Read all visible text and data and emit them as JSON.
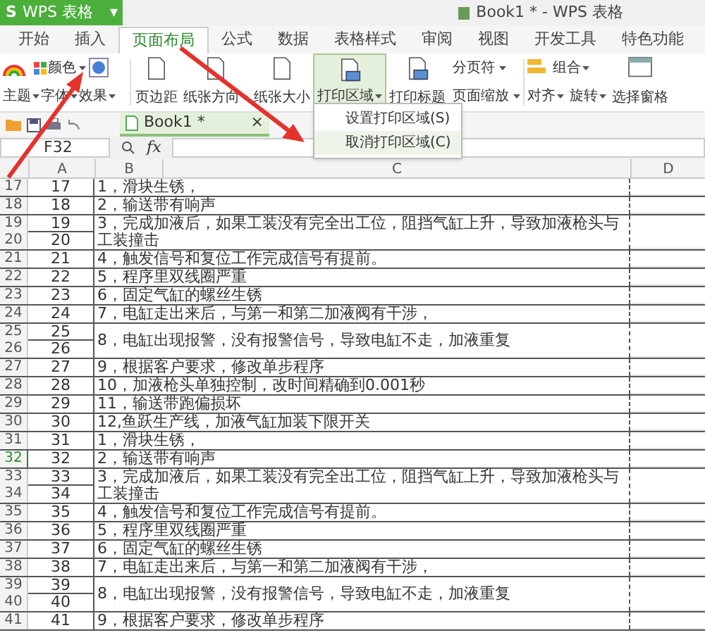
{
  "app_button": {
    "logo": "S",
    "label": "WPS 表格",
    "caret": "▾"
  },
  "window": {
    "title": "Book1 * - WPS 表格"
  },
  "tabs": [
    {
      "label": "开始",
      "selected": false
    },
    {
      "label": "插入",
      "selected": false
    },
    {
      "label": "页面布局",
      "selected": true
    },
    {
      "label": "公式",
      "selected": false
    },
    {
      "label": "数据",
      "selected": false
    },
    {
      "label": "表格样式",
      "selected": false
    },
    {
      "label": "审阅",
      "selected": false
    },
    {
      "label": "视图",
      "selected": false
    },
    {
      "label": "开发工具",
      "selected": false
    },
    {
      "label": "特色功能",
      "selected": false
    }
  ],
  "ribbon": {
    "theme": "主题",
    "colors": "颜色",
    "font": "字体",
    "effects": "效果",
    "big_buttons": [
      {
        "label": "页边距",
        "caret": false,
        "active": false
      },
      {
        "label": "纸张方向",
        "caret": true,
        "active": false
      },
      {
        "label": "纸张大小",
        "caret": false,
        "active": false
      },
      {
        "label": "打印区域",
        "caret": true,
        "active": true
      },
      {
        "label": "打印标题",
        "caret": false,
        "active": false
      }
    ],
    "page_break": "分页符",
    "page_zoom": "页面缩放",
    "align": "对齐",
    "group": "组合",
    "rotate": "旋转",
    "selection_pane": "选择窗格"
  },
  "document_tab": {
    "title": "Book1 *",
    "close": "×"
  },
  "menu": {
    "items": [
      {
        "label": "设置打印区域(S)",
        "hovered": false
      },
      {
        "label": "取消打印区域(C)",
        "hovered": true
      }
    ]
  },
  "formula_bar": {
    "name_box": "F32",
    "fx": "fx"
  },
  "sheet": {
    "columns": [
      "A",
      "B",
      "C",
      "D"
    ],
    "entries": [
      {
        "rows": [
          {
            "header": "17",
            "a": "17",
            "selected": false
          }
        ],
        "text": "1，滑块生锈，"
      },
      {
        "rows": [
          {
            "header": "18",
            "a": "18",
            "selected": false
          }
        ],
        "text": "2，输送带有响声"
      },
      {
        "rows": [
          {
            "header": "19",
            "a": "19",
            "selected": false
          },
          {
            "header": "20",
            "a": "20",
            "selected": false
          }
        ],
        "text": "3，完成加液后，如果工装没有完全出工位，阻挡气缸上升，导致加液枪头与工装撞击"
      },
      {
        "rows": [
          {
            "header": "21",
            "a": "21",
            "selected": false
          }
        ],
        "text": "4，触发信号和复位工作完成信号有提前。"
      },
      {
        "rows": [
          {
            "header": "22",
            "a": "22",
            "selected": false
          }
        ],
        "text": "5，程序里双线圈严重"
      },
      {
        "rows": [
          {
            "header": "23",
            "a": "23",
            "selected": false
          }
        ],
        "text": "6，固定气缸的螺丝生锈"
      },
      {
        "rows": [
          {
            "header": "24",
            "a": "24",
            "selected": false
          }
        ],
        "text": "7，电缸走出来后，与第一和第二加液阀有干涉，"
      },
      {
        "rows": [
          {
            "header": "25",
            "a": "25",
            "selected": false
          },
          {
            "header": "26",
            "a": "26",
            "selected": false
          }
        ],
        "text": "8，电缸出现报警，没有报警信号，导致电缸不走，加液重复"
      },
      {
        "rows": [
          {
            "header": "27",
            "a": "27",
            "selected": false
          }
        ],
        "text": "9，根据客户要求，修改单步程序"
      },
      {
        "rows": [
          {
            "header": "28",
            "a": "28",
            "selected": false
          }
        ],
        "text": "10，加液枪头单独控制，改时间精确到0.001秒"
      },
      {
        "rows": [
          {
            "header": "29",
            "a": "29",
            "selected": false
          }
        ],
        "text": "11，输送带跑偏损坏"
      },
      {
        "rows": [
          {
            "header": "30",
            "a": "30",
            "selected": false
          }
        ],
        "text": "12,鱼跃生产线，加液气缸加装下限开关"
      },
      {
        "rows": [
          {
            "header": "31",
            "a": "31",
            "selected": false
          }
        ],
        "text": "1，滑块生锈，"
      },
      {
        "rows": [
          {
            "header": "32",
            "a": "32",
            "selected": true
          }
        ],
        "text": "2，输送带有响声"
      },
      {
        "rows": [
          {
            "header": "33",
            "a": "33",
            "selected": false
          },
          {
            "header": "34",
            "a": "34",
            "selected": false
          }
        ],
        "text": "3，完成加液后，如果工装没有完全出工位，阻挡气缸上升，导致加液枪头与工装撞击"
      },
      {
        "rows": [
          {
            "header": "35",
            "a": "35",
            "selected": false
          }
        ],
        "text": "4，触发信号和复位工作完成信号有提前。"
      },
      {
        "rows": [
          {
            "header": "36",
            "a": "36",
            "selected": false
          }
        ],
        "text": "5，程序里双线圈严重"
      },
      {
        "rows": [
          {
            "header": "37",
            "a": "37",
            "selected": false
          }
        ],
        "text": "6，固定气缸的螺丝生锈"
      },
      {
        "rows": [
          {
            "header": "38",
            "a": "38",
            "selected": false
          }
        ],
        "text": "7，电缸走出来后，与第一和第二加液阀有干涉，"
      },
      {
        "rows": [
          {
            "header": "39",
            "a": "39",
            "selected": false
          },
          {
            "header": "40",
            "a": "40",
            "selected": false
          }
        ],
        "text": "8，电缸出现报警，没有报警信号，导致电缸不走，加液重复"
      },
      {
        "rows": [
          {
            "header": "41",
            "a": "41",
            "selected": false
          }
        ],
        "text": "9，根据客户要求，修改单步程序"
      }
    ]
  }
}
